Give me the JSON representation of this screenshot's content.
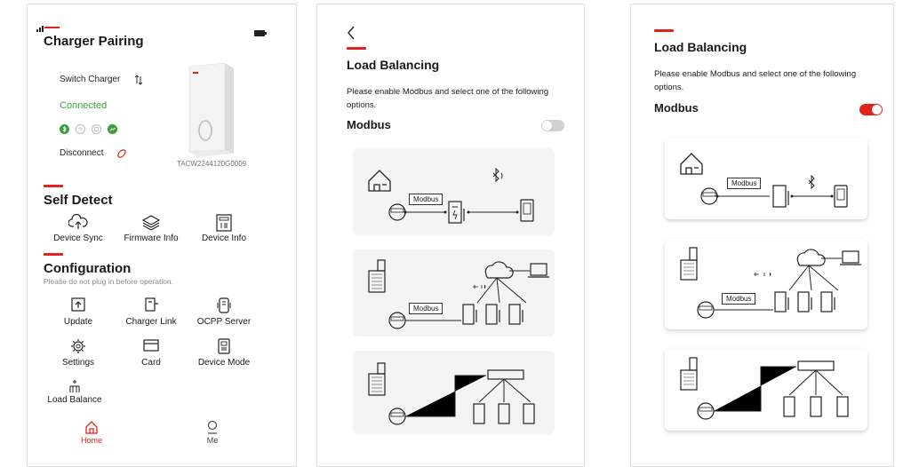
{
  "screen1": {
    "title": "Charger Pairing",
    "switch_charger": "Switch Charger",
    "status": "Connected",
    "disconnect": "Disconnect",
    "serial": "TACW2244120G0009",
    "self_detect": {
      "title": "Self Detect",
      "items": [
        {
          "label": "Device Sync",
          "icon": "cloud-sync-icon"
        },
        {
          "label": "Firmware Info",
          "icon": "layers-icon"
        },
        {
          "label": "Device Info",
          "icon": "device-info-icon"
        }
      ]
    },
    "configuration": {
      "title": "Configuration",
      "note": "Please do not plug in before operation.",
      "items": [
        {
          "label": "Update",
          "icon": "update-icon"
        },
        {
          "label": "Charger Link",
          "icon": "charger-link-icon"
        },
        {
          "label": "OCPP Server",
          "icon": "ocpp-server-icon"
        },
        {
          "label": "Settings",
          "icon": "settings-icon"
        },
        {
          "label": "Card",
          "icon": "card-icon"
        },
        {
          "label": "Device Mode",
          "icon": "device-mode-icon"
        },
        {
          "label": "Load Balance",
          "icon": "load-balance-icon"
        }
      ]
    },
    "nav": {
      "home": "Home",
      "me": "Me"
    }
  },
  "screen2": {
    "title": "Load Balancing",
    "description": "Please enable Modbus and select one of the following options.",
    "modbus_label": "Modbus",
    "modbus_enabled": false,
    "diagram_modbus": "Modbus"
  },
  "screen3": {
    "title": "Load Balancing",
    "description": "Please enable Modbus and select one of the following options.",
    "modbus_label": "Modbus",
    "modbus_enabled": true,
    "diagram_modbus": "Modbus"
  },
  "colors": {
    "accent": "#e2231a",
    "connected": "#3aa23a",
    "toggle_off": "#d0d0d0"
  }
}
